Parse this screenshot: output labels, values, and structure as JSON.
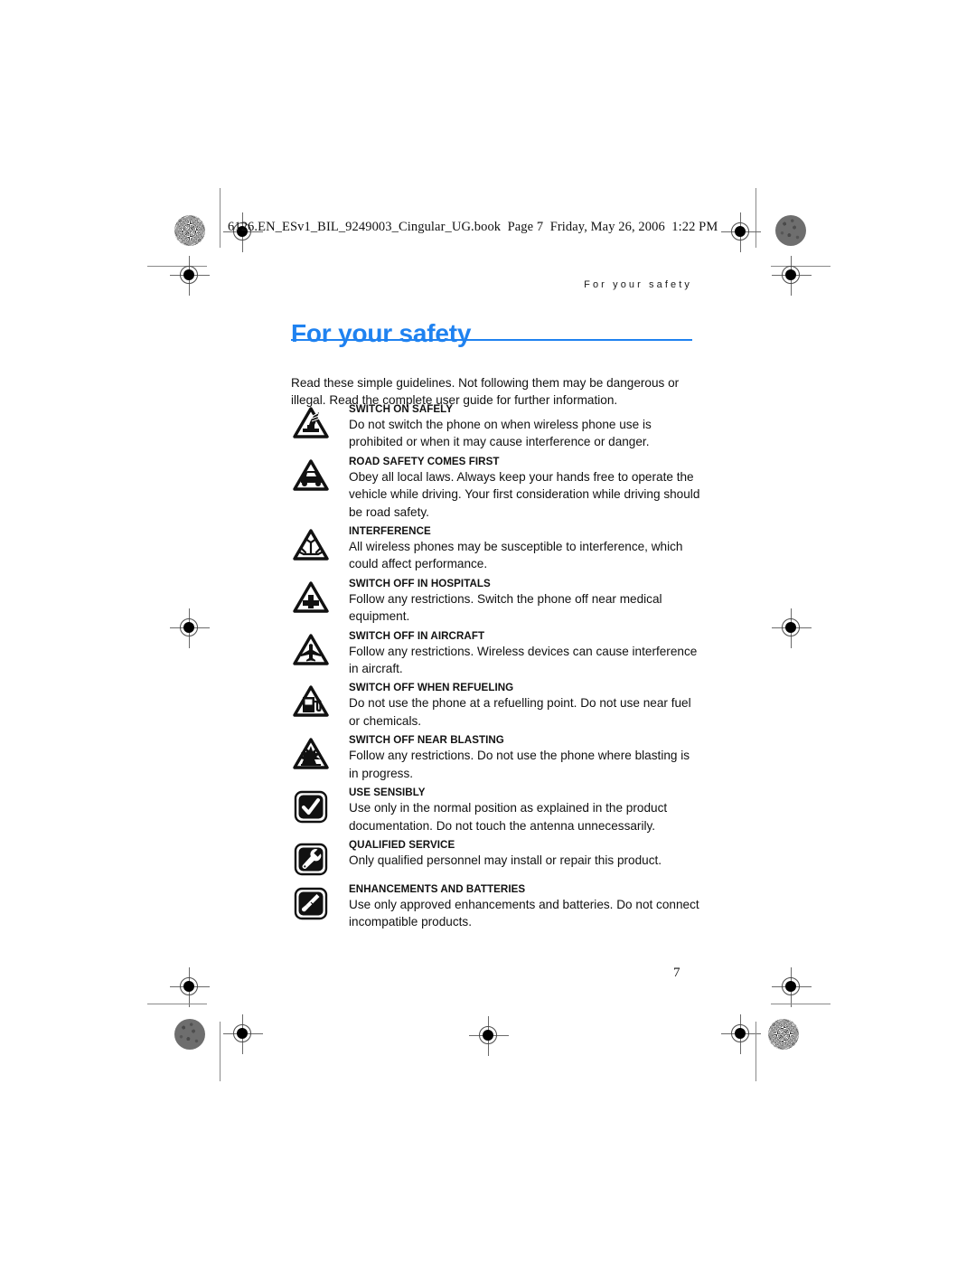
{
  "document": {
    "file_slug": "6126.EN_ESv1_BIL_9249003_Cingular_UG.book  Page 7  Friday, May 26, 2006  1:22 PM",
    "running_head": "For your safety",
    "title": "For your safety",
    "page_number": "7",
    "accent_color": "#1f82f0"
  },
  "intro": {
    "paragraph": "Read these simple guidelines. Not following them may be dangerous or illegal. Read the complete user guide for further information."
  },
  "safety_items": [
    {
      "icon": "switch-on-safely-icon",
      "title": "SWITCH ON SAFELY",
      "body": "Do not switch the phone on when wireless phone use is prohibited or when it may cause interference or danger."
    },
    {
      "icon": "road-safety-car-icon",
      "title": "ROAD SAFETY COMES FIRST",
      "body": "Obey all local laws. Always keep your hands free to operate the vehicle while driving. Your first consideration while driving should be road safety."
    },
    {
      "icon": "interference-antenna-icon",
      "title": "INTERFERENCE",
      "body": "All wireless phones may be susceptible to interference, which could affect performance."
    },
    {
      "icon": "hospital-cross-icon",
      "title": "SWITCH OFF IN HOSPITALS",
      "body": "Follow any restrictions. Switch the phone off near medical equipment."
    },
    {
      "icon": "aircraft-icon",
      "title": "SWITCH OFF IN AIRCRAFT",
      "body": "Follow any restrictions. Wireless devices can cause interference in aircraft."
    },
    {
      "icon": "fuel-pump-icon",
      "title": "SWITCH OFF WHEN REFUELING",
      "body": "Do not use the phone at a refuelling point. Do not use near fuel or chemicals."
    },
    {
      "icon": "blasting-explosion-icon",
      "title": "SWITCH OFF NEAR BLASTING",
      "body": "Follow any restrictions. Do not use the phone where blasting is in progress."
    },
    {
      "icon": "checkmark-icon",
      "title": "USE SENSIBLY",
      "body": "Use only in the normal position as explained in the product documentation. Do not touch the antenna unnecessarily."
    },
    {
      "icon": "wrench-icon",
      "title": "QUALIFIED SERVICE",
      "body": "Only qualified personnel may install or repair this product."
    },
    {
      "icon": "battery-connector-icon",
      "title": "ENHANCEMENTS AND BATTERIES",
      "body": "Use only approved enhancements and batteries. Do not connect incompatible products."
    }
  ]
}
